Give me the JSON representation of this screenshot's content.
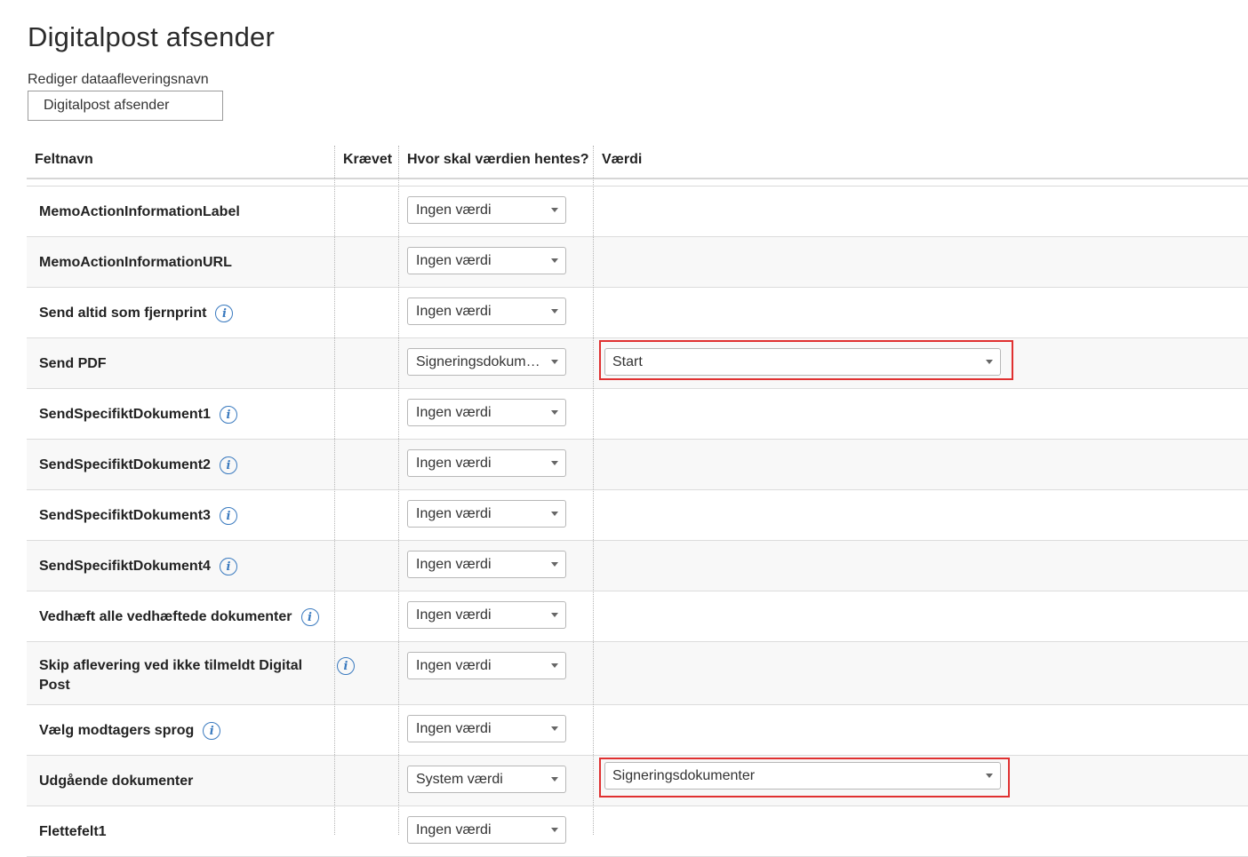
{
  "page": {
    "title": "Digitalpost afsender"
  },
  "name_field": {
    "label": "Rediger dataafleveringsnavn",
    "value": "Digitalpost afsender"
  },
  "table": {
    "headers": {
      "fieldname": "Feltnavn",
      "required": "Krævet",
      "source": "Hvor skal værdien hentes?",
      "value": "Værdi"
    },
    "rows": [
      {
        "name": "MemoActionInformationLabel",
        "info": false,
        "source": "Ingen værdi"
      },
      {
        "name": "MemoActionInformationURL",
        "info": false,
        "source": "Ingen værdi"
      },
      {
        "name": "Send altid som fjernprint",
        "info": true,
        "source": "Ingen værdi"
      },
      {
        "name": "Send PDF",
        "info": false,
        "source": "Signeringsdokumenter",
        "value": "Start"
      },
      {
        "name": "SendSpecifiktDokument1",
        "info": true,
        "source": "Ingen værdi"
      },
      {
        "name": "SendSpecifiktDokument2",
        "info": true,
        "source": "Ingen værdi"
      },
      {
        "name": "SendSpecifiktDokument3",
        "info": true,
        "source": "Ingen værdi"
      },
      {
        "name": "SendSpecifiktDokument4",
        "info": true,
        "source": "Ingen værdi"
      },
      {
        "name": "Vedhæft alle vedhæftede dokumenter",
        "info": true,
        "source": "Ingen værdi"
      },
      {
        "name": "Skip aflevering ved ikke tilmeldt Digital Post",
        "info": true,
        "source": "Ingen værdi"
      },
      {
        "name": "Vælg modtagers sprog",
        "info": true,
        "source": "Ingen værdi"
      },
      {
        "name": "Udgående dokumenter",
        "info": false,
        "source": "System værdi",
        "value": "Signeringsdokumenter"
      },
      {
        "name": "Flettefelt1",
        "info": false,
        "source": "Ingen værdi"
      }
    ]
  },
  "icons": {
    "info": "info-icon",
    "dropdown": "caret-down-icon"
  },
  "colors": {
    "highlight_border": "#e03131",
    "info_icon": "#3a7abf",
    "alt_row": "#f8f8f8"
  }
}
